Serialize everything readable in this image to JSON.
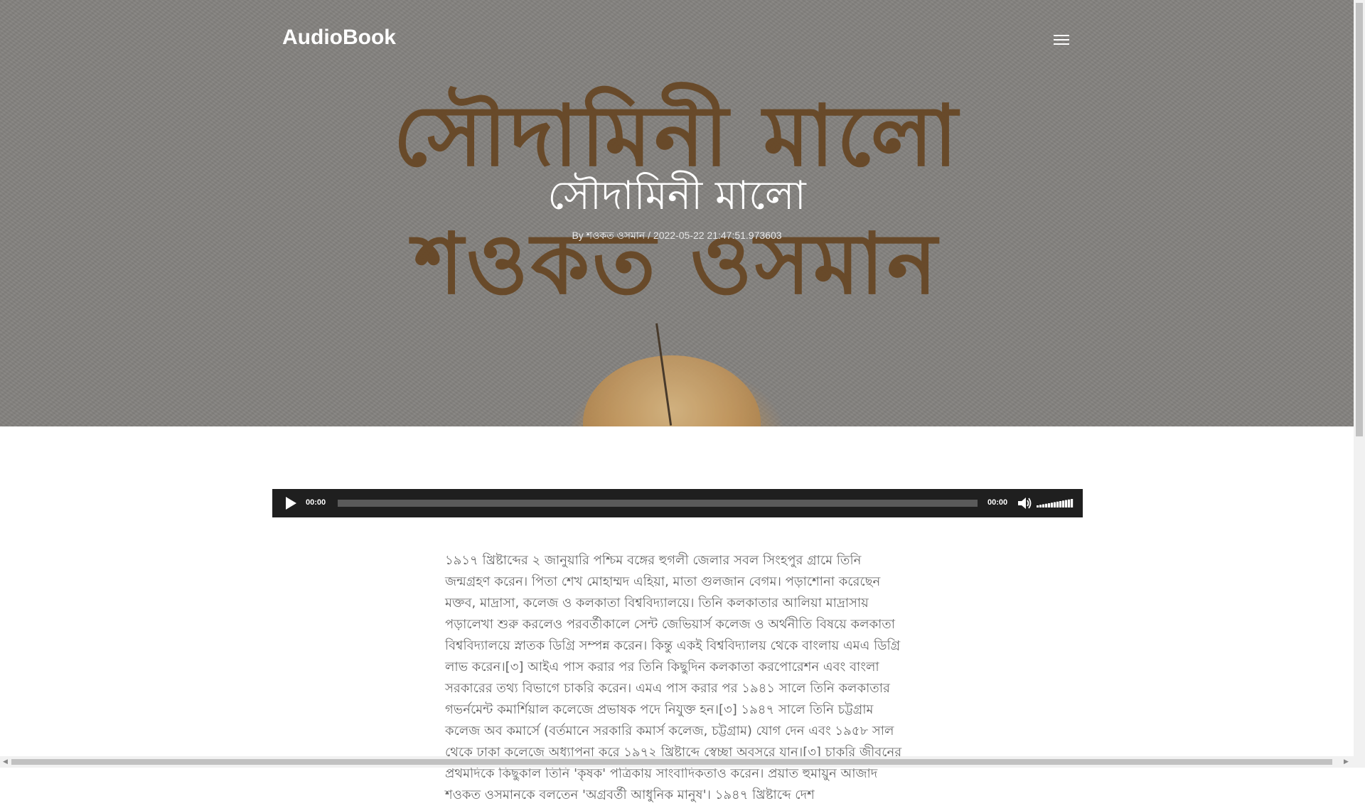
{
  "header": {
    "brand": "AudioBook",
    "menu_icon": "hamburger-menu-icon"
  },
  "hero": {
    "art_line1": "সৌদামিনী মালো",
    "art_line2": "শওকত ওসমান",
    "title": "সৌদামিনী মালো",
    "meta": {
      "by": "By",
      "author": "শওকত ওসমান",
      "separator": "/",
      "timestamp": "2022-05-22 21:47:51.973603"
    }
  },
  "player": {
    "current_time": "00:00",
    "duration": "00:00",
    "progress": 0,
    "play_icon": "play-icon",
    "mute_icon": "speaker-icon",
    "volume": 1.0
  },
  "content": {
    "text": "১৯১৭ খ্রিষ্টাব্দের ২ জানুয়ারি পশ্চিম বঙ্গের হুগলী জেলার সবল সিংহপুর গ্রামে তিনি জন্মগ্রহণ করেন। পিতা শেখ মোহাম্মদ এহিয়া, মাতা গুলজান বেগম। পড়াশোনা করেছেন মক্তব, মাদ্রাসা, কলেজ ও কলকাতা বিশ্ববিদ্যালয়ে। তিনি কলকাতার আলিয়া মাদ্রাসায় পড়ালেখা শুরু করলেও পরবর্তীকালে সেন্ট জেভিয়ার্স কলেজ ও অর্থনীতি বিষয়ে কলকাতা বিশ্ববিদ্যালয়ে স্নাতক ডিগ্রি সম্পন্ন করেন। কিন্তু একই বিশ্ববিদ্যালয় থেকে বাংলায় এমএ ডিগ্রি লাভ করেন।[৩] আইএ পাস করার পর তিনি কিছুদিন কলকাতা করপোরেশন এবং বাংলা সরকারের তথ্য বিভাগে চাকরি করেন। এমএ পাস করার পর ১৯৪১ সালে তিনি কলকাতার গভর্নমেন্ট কমার্শিয়াল কলেজে প্রভাষক পদে নিযুক্ত হন।[৩] ১৯৪৭ সালে তিনি চট্টগ্রাম কলেজ অব কমার্সে (বর্তমানে সরকারি কমার্স কলেজ, চট্টগ্রাম) যোগ দেন এবং ১৯৫৮ সাল থেকে ঢাকা কলেজে অধ্যাপনা করে ১৯৭২ খ্রিষ্টাব্দে স্বেচ্ছা অবসরে যান।[৩] চাকরি জীবনের প্রথমদিকে কিছুকাল তিনি 'কৃষক' পত্রিকায় সাংবাদিকতাও করেন। প্রয়াত হুমায়ুন আজাদ শওকত ওসমানকে বলতেন 'অগ্রবর্তী আধুনিক মানুষ'। ১৯৪৭ খ্রিষ্টাব্দে দেশ"
  }
}
